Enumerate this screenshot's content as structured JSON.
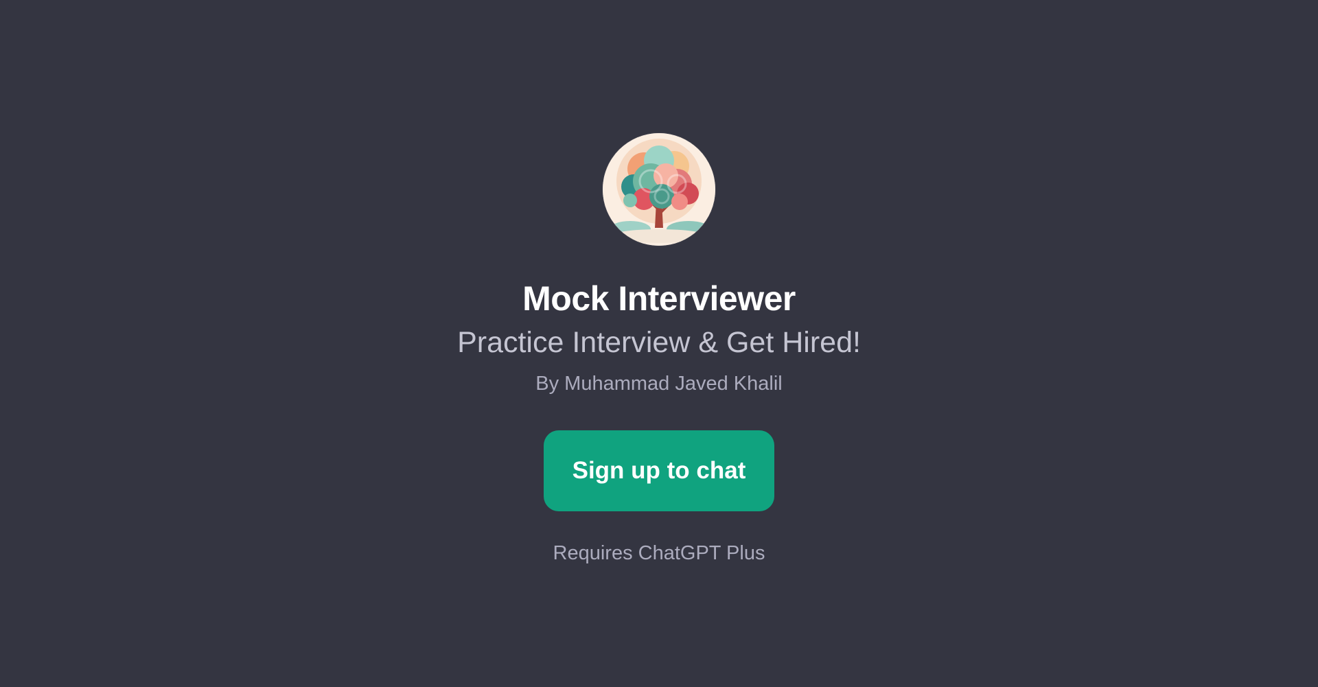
{
  "gpt": {
    "avatar_icon": "tree-logo-icon",
    "title": "Mock Interviewer",
    "subtitle": "Practice Interview & Get Hired!",
    "author": "By Muhammad Javed Khalil"
  },
  "cta": {
    "label": "Sign up to chat"
  },
  "note": "Requires ChatGPT Plus",
  "colors": {
    "background": "#343541",
    "accent": "#10a37f",
    "title": "#ffffff",
    "subtitle": "#c5c5d2",
    "muted": "#acacbe"
  }
}
